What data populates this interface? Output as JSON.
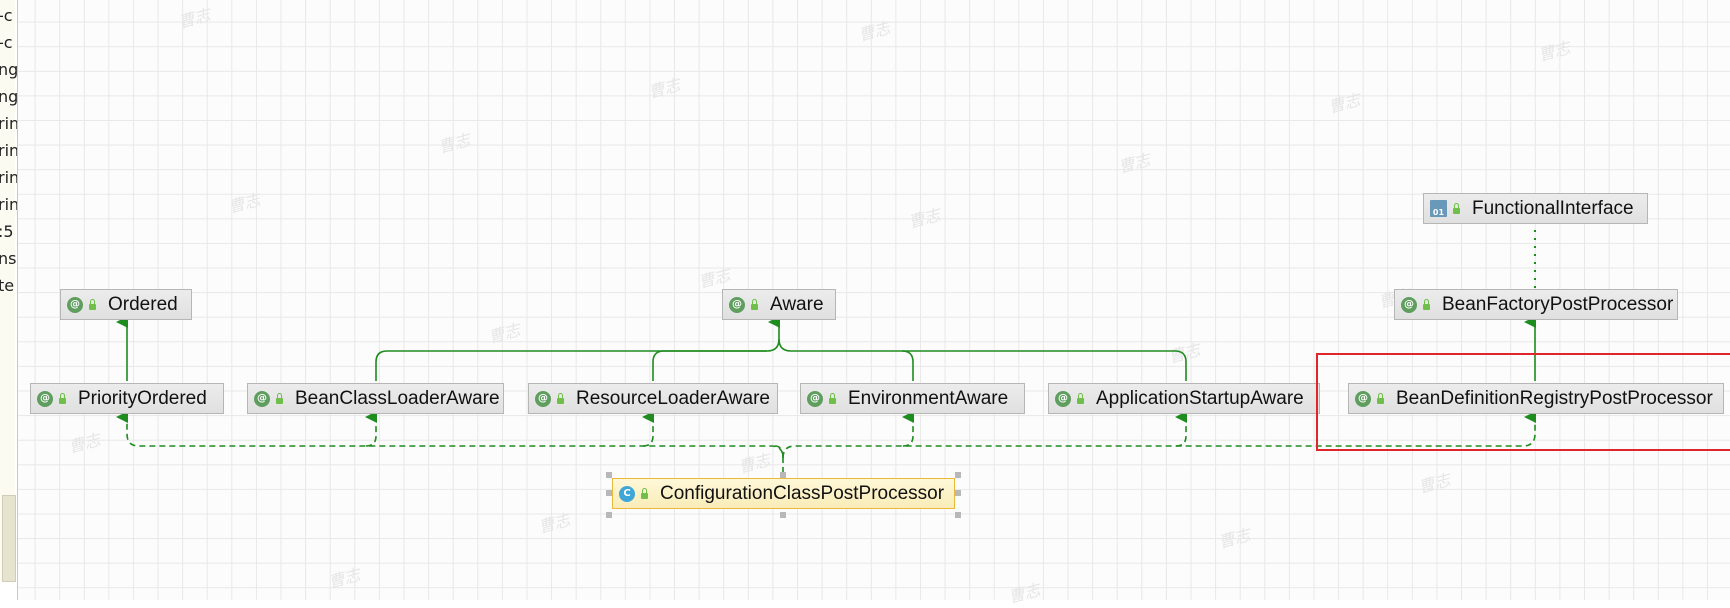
{
  "left_panel": {
    "fragments": [
      "-c",
      "-c",
      "ng",
      "ng",
      "rin",
      "rin",
      "rin",
      "rin",
      ":5",
      "ns",
      "te"
    ]
  },
  "diagram": {
    "nodes": {
      "functional_interface": {
        "label": "FunctionalInterface",
        "kind": "annotation-icon",
        "kind_text": "01"
      },
      "ordered": {
        "label": "Ordered",
        "kind": "interface-icon",
        "kind_text": "@"
      },
      "aware": {
        "label": "Aware",
        "kind": "interface-icon",
        "kind_text": "@"
      },
      "bean_factory_post_processor": {
        "label": "BeanFactoryPostProcessor",
        "kind": "interface-icon",
        "kind_text": "@"
      },
      "priority_ordered": {
        "label": "PriorityOrdered",
        "kind": "interface-icon",
        "kind_text": "@"
      },
      "bean_class_loader_aware": {
        "label": "BeanClassLoaderAware",
        "kind": "interface-icon",
        "kind_text": "@"
      },
      "resource_loader_aware": {
        "label": "ResourceLoaderAware",
        "kind": "interface-icon",
        "kind_text": "@"
      },
      "environment_aware": {
        "label": "EnvironmentAware",
        "kind": "interface-icon",
        "kind_text": "@"
      },
      "application_startup_aware": {
        "label": "ApplicationStartupAware",
        "kind": "interface-icon",
        "kind_text": "@"
      },
      "bean_definition_registry_post_processor": {
        "label": "BeanDefinitionRegistryPostProcessor",
        "kind": "interface-icon",
        "kind_text": "@"
      },
      "configuration_class_post_processor": {
        "label": "ConfigurationClassPostProcessor",
        "kind": "class-icon",
        "kind_text": "C"
      }
    },
    "colors": {
      "edge": "#1e8c1e",
      "highlight": "#e0262c",
      "selection_border": "#e8b93a"
    }
  }
}
